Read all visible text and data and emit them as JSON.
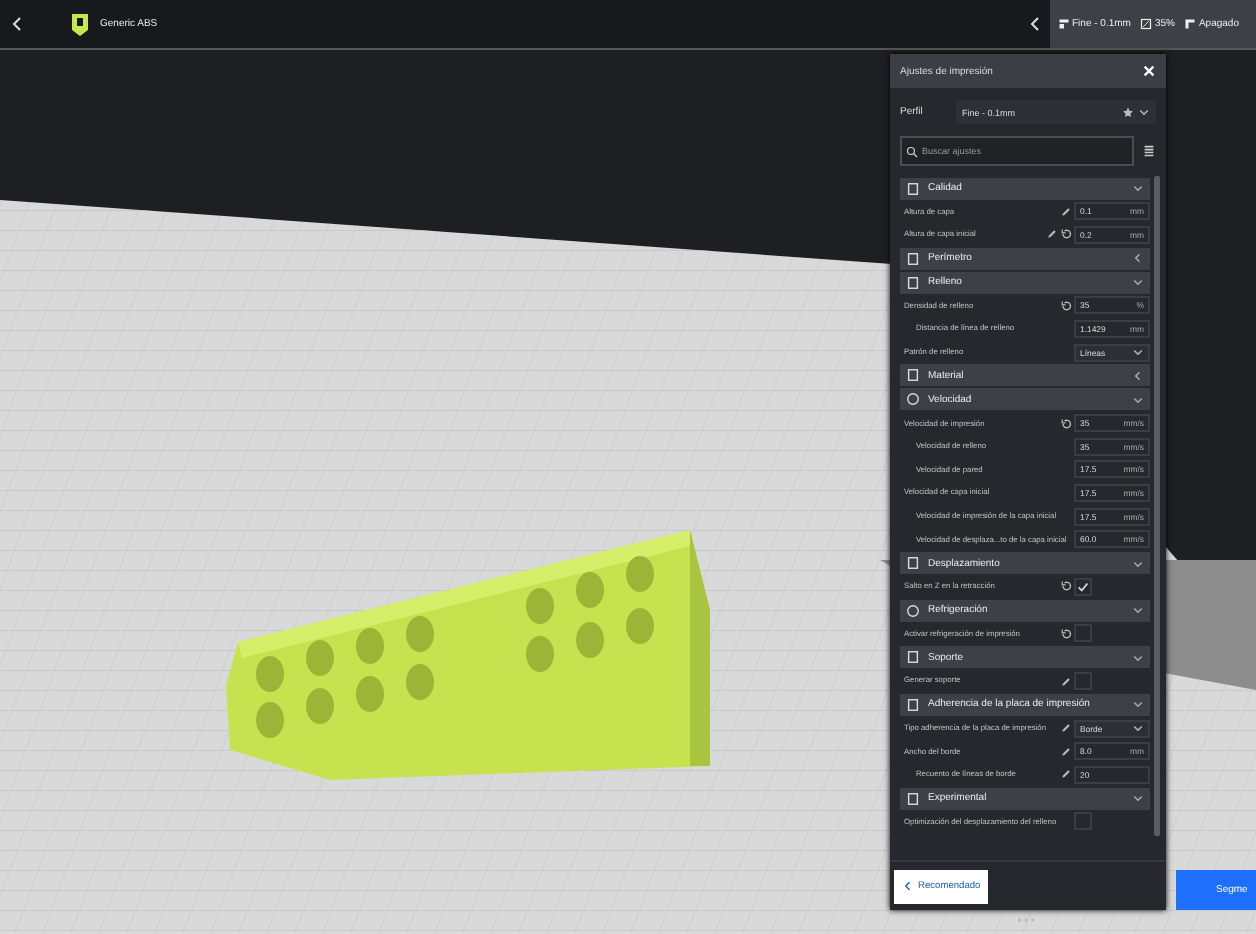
{
  "top_bar": {
    "material": "Generic ABS",
    "profile": "Fine - 0.1mm",
    "infill": "35%",
    "support": "Apagado"
  },
  "settings_panel": {
    "title": "Ajustes de impresión",
    "profile_label": "Perfil",
    "profile_value": "Fine - 0.1mm",
    "search_placeholder": "Buscar ajustes",
    "footer_button": "Recomendado",
    "rows": [
      {
        "kind": "category",
        "label": "Calidad",
        "expanded": true
      },
      {
        "kind": "number",
        "label": "Altura de capa",
        "value": "0.1",
        "unit": "mm",
        "indent": false,
        "edited": true,
        "resettable": false
      },
      {
        "kind": "number",
        "label": "Altura de capa inicial",
        "value": "0.2",
        "unit": "mm",
        "indent": false,
        "edited": true,
        "resettable": true
      },
      {
        "kind": "category",
        "label": "Perímetro",
        "expanded": false
      },
      {
        "kind": "category",
        "label": "Relleno",
        "expanded": true
      },
      {
        "kind": "number",
        "label": "Densidad de relleno",
        "value": "35",
        "unit": "%",
        "indent": false,
        "edited": false,
        "resettable": true
      },
      {
        "kind": "number",
        "label": "Distancia de línea de relleno",
        "value": "1.1429",
        "unit": "mm",
        "indent": true,
        "edited": false,
        "resettable": false
      },
      {
        "kind": "dropdown",
        "label": "Patrón de relleno",
        "value": "Líneas",
        "indent": false,
        "edited": false,
        "resettable": false
      },
      {
        "kind": "category",
        "label": "Material",
        "expanded": false
      },
      {
        "kind": "category",
        "label": "Velocidad",
        "expanded": true
      },
      {
        "kind": "number",
        "label": "Velocidad de impresión",
        "value": "35",
        "unit": "mm/s",
        "indent": false,
        "edited": false,
        "resettable": true
      },
      {
        "kind": "number",
        "label": "Velocidad de relleno",
        "value": "35",
        "unit": "mm/s",
        "indent": true,
        "edited": false,
        "resettable": false
      },
      {
        "kind": "number",
        "label": "Velocidad de pared",
        "value": "17.5",
        "unit": "mm/s",
        "indent": true,
        "edited": false,
        "resettable": false
      },
      {
        "kind": "number",
        "label": "Velocidad de capa inicial",
        "value": "17.5",
        "unit": "mm/s",
        "indent": false,
        "edited": false,
        "resettable": false
      },
      {
        "kind": "number",
        "label": "Velocidad de impresión de la capa inicial",
        "value": "17.5",
        "unit": "mm/s",
        "indent": true,
        "edited": false,
        "resettable": false
      },
      {
        "kind": "number",
        "label": "Velocidad de desplaza...to de la capa inicial",
        "value": "60.0",
        "unit": "mm/s",
        "indent": true,
        "edited": false,
        "resettable": false
      },
      {
        "kind": "category",
        "label": "Desplazamiento",
        "expanded": true
      },
      {
        "kind": "checkbox",
        "label": "Salto en Z en la retracción",
        "checked": true,
        "indent": false,
        "edited": false,
        "resettable": true
      },
      {
        "kind": "category",
        "label": "Refrigeración",
        "expanded": true
      },
      {
        "kind": "checkbox",
        "label": "Activar refrigeración de impresión",
        "checked": false,
        "indent": false,
        "edited": false,
        "resettable": true
      },
      {
        "kind": "category",
        "label": "Soporte",
        "expanded": true
      },
      {
        "kind": "checkbox",
        "label": "Generar soporte",
        "checked": false,
        "indent": false,
        "edited": true,
        "resettable": false
      },
      {
        "kind": "category",
        "label": "Adherencia de la placa de impresión",
        "expanded": true
      },
      {
        "kind": "dropdown",
        "label": "Tipo adherencia de la placa de impresión",
        "value": "Borde",
        "indent": false,
        "edited": true,
        "resettable": false
      },
      {
        "kind": "number",
        "label": "Ancho del borde",
        "value": "8.0",
        "unit": "mm",
        "indent": false,
        "edited": true,
        "resettable": false
      },
      {
        "kind": "number",
        "label": "Recuento de líneas de borde",
        "value": "20",
        "unit": "",
        "indent": true,
        "edited": true,
        "resettable": false
      },
      {
        "kind": "category",
        "label": "Experimental",
        "expanded": true
      },
      {
        "kind": "checkbox",
        "label": "Optimización del desplazamiento del relleno",
        "checked": false,
        "indent": false,
        "edited": false,
        "resettable": false
      }
    ]
  },
  "slice_button": "Segme"
}
